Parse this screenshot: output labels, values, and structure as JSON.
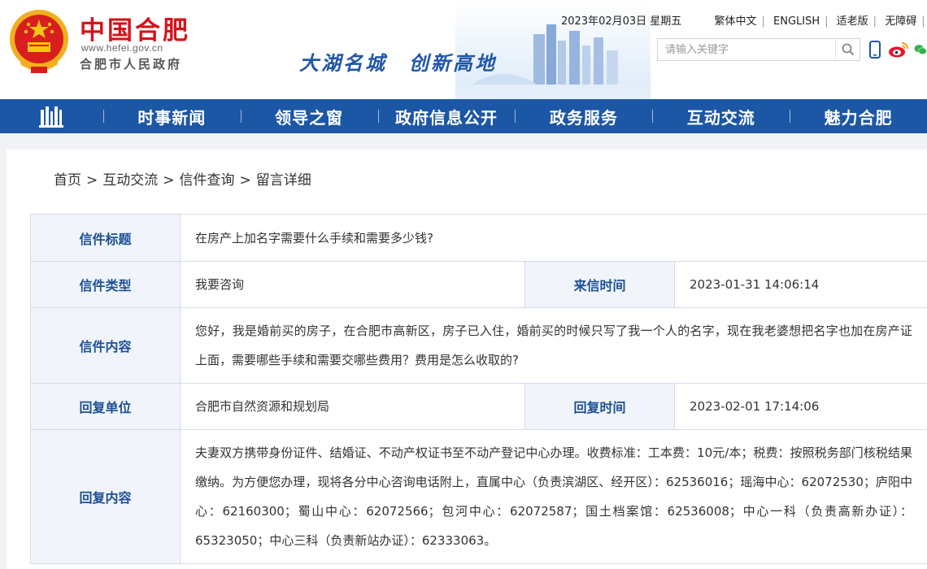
{
  "header": {
    "brand_name": "中国合肥",
    "brand_url": "www.hefei.gov.cn",
    "brand_org": "合肥市人民政府",
    "slogan": "大湖名城　创新高地",
    "date": "2023年02月03日 星期五",
    "links": [
      "繁体中文",
      "ENGLISH",
      "适老版",
      "无障碍"
    ],
    "search_placeholder": "请输入关键字",
    "icons": [
      "mobile-icon",
      "weibo-icon",
      "wechat-icon"
    ]
  },
  "nav": {
    "home_icon": "building-home-icon",
    "items": [
      "时事新闻",
      "领导之窗",
      "政府信息公开",
      "政务服务",
      "互动交流",
      "魅力合肥"
    ]
  },
  "breadcrumb": [
    "首页",
    "互动交流",
    "信件查询",
    "留言详细"
  ],
  "letter": {
    "title_label": "信件标题",
    "title": "在房产上加名字需要什么手续和需要多少钱?",
    "type_label": "信件类型",
    "type": "我要咨询",
    "sent_label": "来信时间",
    "sent_time": "2023-01-31 14:06:14",
    "content_label": "信件内容",
    "content": "您好，我是婚前买的房子，在合肥市高新区，房子已入住，婚前买的时候只写了我一个人的名字，现在我老婆想把名字也加在房产证上面，需要哪些手续和需要交哪些费用？费用是怎么收取的?",
    "reply_unit_label": "回复单位",
    "reply_unit": "合肥市自然资源和规划局",
    "reply_time_label": "回复时间",
    "reply_time": "2023-02-01 17:14:06",
    "reply_content_label": "回复内容",
    "reply_content": "夫妻双方携带身份证件、结婚证、不动产权证书至不动产登记中心办理。收费标准：工本费：10元/本；税费：按照税务部门核税结果缴纳。为方便您办理，现将各分中心咨询电话附上，直属中心（负责滨湖区、经开区）：62536016；瑶海中心：62072530；庐阳中心：62160300；蜀山中心：62072566；包河中心：62072587；国土档案馆：62536008；中心一科（负责高新办证）：65323050；中心三科（负责新站办证）：62333063。"
  },
  "colors": {
    "brand_red": "#d4141a",
    "nav_blue": "#1c57a5",
    "label_blue": "#1c4f96",
    "label_bg": "#f1f5fb"
  }
}
